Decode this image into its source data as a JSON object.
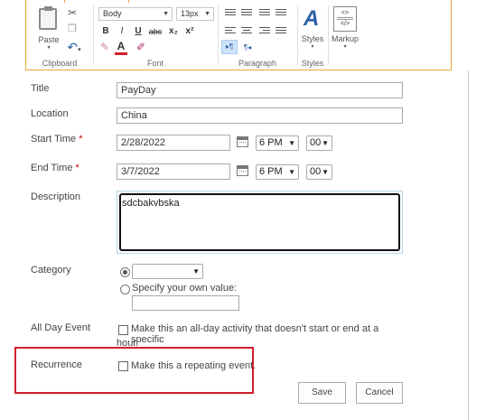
{
  "ribbon": {
    "clipboard": {
      "paste_label": "Paste",
      "group_label": "Clipboard"
    },
    "font": {
      "style_value": "Body",
      "size_value": "13px",
      "bold": "B",
      "italic": "I",
      "underline": "U",
      "strike": "abc",
      "subscript": "x₂",
      "superscript": "x²",
      "font_color_glyph": "A",
      "group_label": "Font"
    },
    "paragraph": {
      "group_label": "Paragraph",
      "ltr": "▸¶",
      "rtl": "¶◂"
    },
    "styles": {
      "label": "Styles",
      "glyph": "A",
      "group_label": "Styles"
    },
    "markup": {
      "label": "Markup",
      "glyph_top": "<>",
      "glyph_bottom": "</>"
    }
  },
  "form": {
    "title": {
      "label": "Title",
      "value": "PayDay"
    },
    "location": {
      "label": "Location",
      "value": "China"
    },
    "start_time": {
      "label": "Start Time",
      "required": "*",
      "date": "2/28/2022",
      "hour": "6 PM",
      "minute": "00"
    },
    "end_time": {
      "label": "End Time",
      "required": "*",
      "date": "3/7/2022",
      "hour": "6 PM",
      "minute": "00"
    },
    "description": {
      "label": "Description",
      "value": "sdcbakvbska"
    },
    "category": {
      "label": "Category",
      "selected_value": "",
      "own_value_label": "Specify your own value:",
      "own_value": ""
    },
    "all_day": {
      "label": "All Day Event",
      "text_line1": "Make this an all-day activity that doesn't start or end at a specific",
      "text_line2": "hour."
    },
    "recurrence": {
      "label": "Recurrence",
      "text": "Make this a repeating event."
    },
    "buttons": {
      "save": "Save",
      "cancel": "Cancel"
    }
  },
  "colors": {
    "ribbon_border": "#e8a83c",
    "highlight_box": "#d21f2b",
    "description_focus": "#111111"
  },
  "icons": [
    "cut-icon",
    "copy-icon",
    "undo-icon",
    "paste-icon",
    "calendar-icon",
    "styles-icon",
    "markup-icon"
  ]
}
